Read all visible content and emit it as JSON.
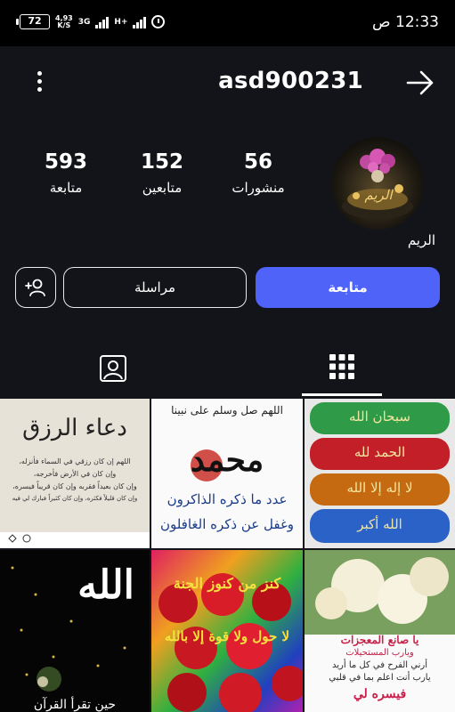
{
  "status_bar": {
    "battery": "72",
    "speed_value": "4,93",
    "speed_unit": "K/S",
    "network_1": "3G",
    "network_2": "H+",
    "time": "12:33 ص"
  },
  "profile": {
    "username": "asd900231",
    "display_name": "الريم",
    "avatar_text": "الريم",
    "stats": {
      "posts_count": "56",
      "posts_label": "منشورات",
      "followers_count": "152",
      "followers_label": "متابعين",
      "following_count": "593",
      "following_label": "متابعة"
    }
  },
  "actions": {
    "follow_label": "متابعة",
    "message_label": "مراسلة"
  },
  "tabs": [
    {
      "name": "posts-grid",
      "selected": true
    },
    {
      "name": "tagged",
      "selected": false
    }
  ],
  "posts": [
    {
      "title": "دعاء الرزق",
      "lines": [
        "اللهم إن كان رزقي في السماء فأنزله،",
        "وإن كان في الأرض فأخرجه،",
        "وإن كان بعيداً فقربه وإن كان قريباً فيسره،",
        "وإن كان قليلاً فكثره، وإن كان كثيراً فبارك لي فيه"
      ]
    },
    {
      "title": "محمد",
      "top": "اللهم صل وسلم على نبينا",
      "line1": "عدد ما ذكره الذاكرون",
      "line2": "وغفل عن ذكره الغافلون"
    },
    {
      "lines": [
        "سبحان الله",
        "الحمد لله",
        "لا إله إلا الله",
        "الله أكبر"
      ]
    },
    {
      "title": "الله",
      "bottom": "حين تقرأ القرآن"
    },
    {
      "line1": "كنز من كنوز الجنة",
      "line2": "لا حول ولا قوة إلا بالله"
    },
    {
      "line1": "يا صانع المعجزات",
      "line2": "ويارب المستحيلات",
      "line3": "أرني الفرح في كل ما أريد",
      "line4": "يارب أنت اعلم بما في قلبي",
      "line5": "فيسره لي"
    }
  ],
  "colors": {
    "accent": "#4f63f8",
    "background": "#12141a",
    "status_bar": "#000000"
  }
}
